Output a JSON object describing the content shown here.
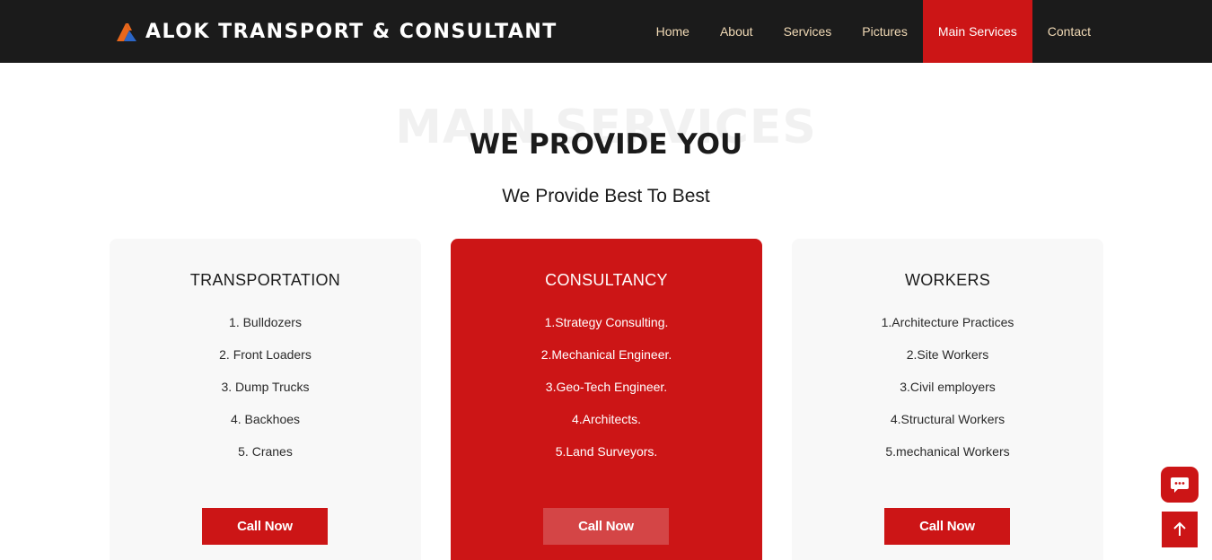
{
  "brand": {
    "name": "ALOK TRANSPORT & CONSULTANT"
  },
  "nav": {
    "items": [
      "Home",
      "About",
      "Services",
      "Pictures",
      "Main Services",
      "Contact"
    ],
    "active": "Main Services"
  },
  "section": {
    "background_title": "MAIN SERVICES",
    "title": "WE PROVIDE YOU",
    "subtitle": "We Provide Best To Best"
  },
  "cards": [
    {
      "title": "TRANSPORTATION",
      "items": [
        "1. Bulldozers",
        "2. Front Loaders",
        "3. Dump Trucks",
        "4. Backhoes",
        "5. Cranes"
      ],
      "button": "Call Now"
    },
    {
      "title": "CONSULTANCY",
      "items": [
        "1.Strategy Consulting.",
        "2.Mechanical Engineer.",
        "3.Geo-Tech Engineer.",
        "4.Architects.",
        "5.Land Surveyors."
      ],
      "button": "Call Now"
    },
    {
      "title": "WORKERS",
      "items": [
        "1.Architecture Practices",
        "2.Site Workers",
        "3.Civil employers",
        "4.Structural Workers",
        "5.mechanical Workers"
      ],
      "button": "Call Now"
    }
  ],
  "floating": {
    "chat_icon": "chat-bubble-icon",
    "top_icon": "arrow-up-icon"
  },
  "colors": {
    "accent": "#cc1516",
    "header_bg": "#1b1b1b",
    "nav_text": "#f0d9b5",
    "card_bg": "#f8f8f8"
  }
}
